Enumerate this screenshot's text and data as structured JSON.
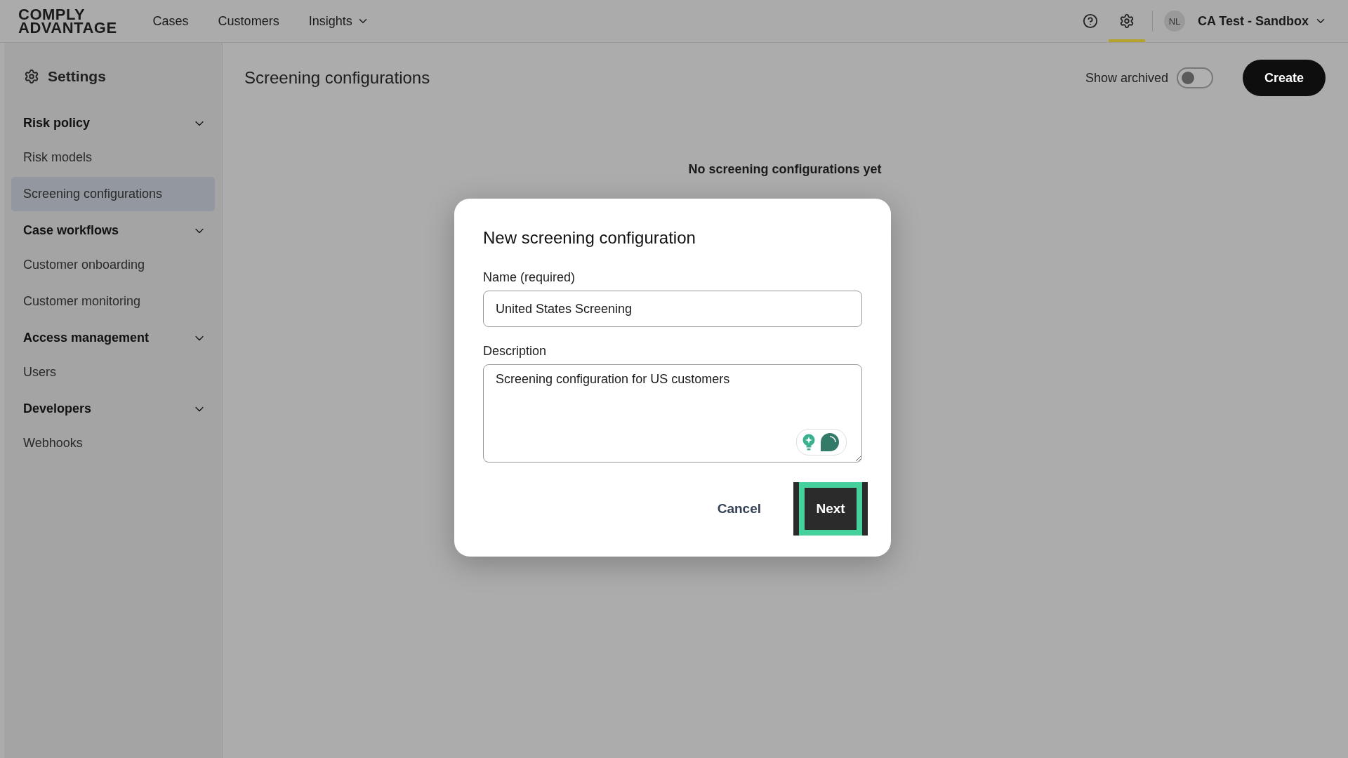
{
  "header": {
    "logo": [
      "COMPLY",
      "ADVANTAGE"
    ],
    "nav": [
      {
        "label": "Cases",
        "has_menu": false
      },
      {
        "label": "Customers",
        "has_menu": false
      },
      {
        "label": "Insights",
        "has_menu": true
      }
    ],
    "settings_selected": true,
    "avatar": "NL",
    "account": "CA Test - Sandbox"
  },
  "sidebar": {
    "title": "Settings",
    "sections": [
      {
        "label": "Risk policy",
        "expanded": true,
        "items": [
          {
            "label": "Risk models",
            "selected": false
          },
          {
            "label": "Screening configurations",
            "selected": true
          }
        ]
      },
      {
        "label": "Case workflows",
        "expanded": true,
        "items": [
          {
            "label": "Customer onboarding",
            "selected": false
          },
          {
            "label": "Customer monitoring",
            "selected": false
          }
        ]
      },
      {
        "label": "Access management",
        "expanded": true,
        "items": [
          {
            "label": "Users",
            "selected": false
          }
        ]
      },
      {
        "label": "Developers",
        "expanded": true,
        "items": [
          {
            "label": "Webhooks",
            "selected": false
          }
        ]
      }
    ]
  },
  "main": {
    "title": "Screening configurations",
    "show_archived": {
      "label": "Show archived",
      "on": false
    },
    "create": "Create",
    "empty_title": "No screening configurations yet"
  },
  "dialog": {
    "title": "New screening configuration",
    "name_label": "Name (required)",
    "name_value": "United States Screening",
    "description_label": "Description",
    "description_value": "Screening configuration for US customers",
    "cancel": "Cancel",
    "next": "Next"
  }
}
